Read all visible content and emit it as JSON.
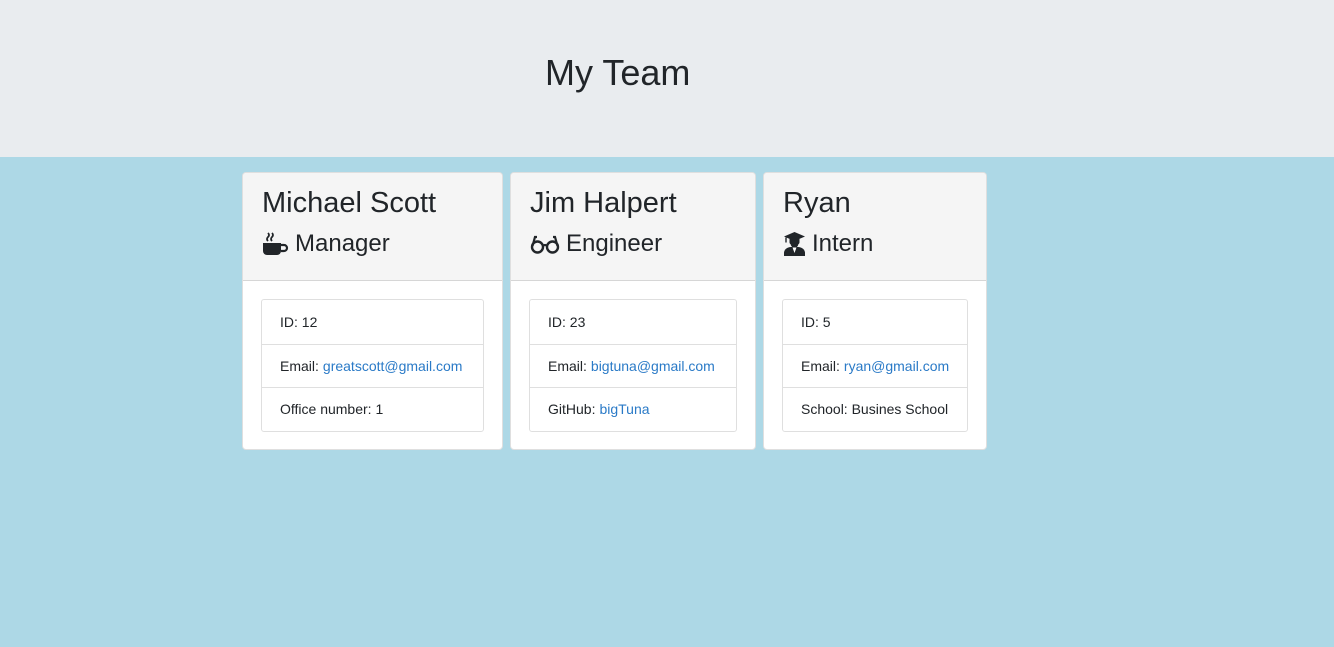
{
  "header": {
    "title": "My Team"
  },
  "employees": [
    {
      "name": "Michael Scott",
      "role": "Manager",
      "icon": "mug-icon",
      "id_label": "ID: 12",
      "email_prefix": "Email:",
      "email": "greatscott@gmail.com",
      "extra_prefix": "Office number: 1",
      "extra_link": ""
    },
    {
      "name": "Jim Halpert",
      "role": "Engineer",
      "icon": "glasses-icon",
      "id_label": "ID: 23",
      "email_prefix": "Email:",
      "email": "bigtuna@gmail.com",
      "extra_prefix": "GitHub:",
      "extra_link": "bigTuna"
    },
    {
      "name": "Ryan",
      "role": "Intern",
      "icon": "graduate-icon",
      "id_label": "ID: 5",
      "email_prefix": "Email:",
      "email": "ryan@gmail.com",
      "extra_prefix": "School: Busines School",
      "extra_link": ""
    }
  ],
  "colors": {
    "page_bg": "#add8e6",
    "header_bg": "#e9ecef",
    "link": "#2a7ac7"
  }
}
